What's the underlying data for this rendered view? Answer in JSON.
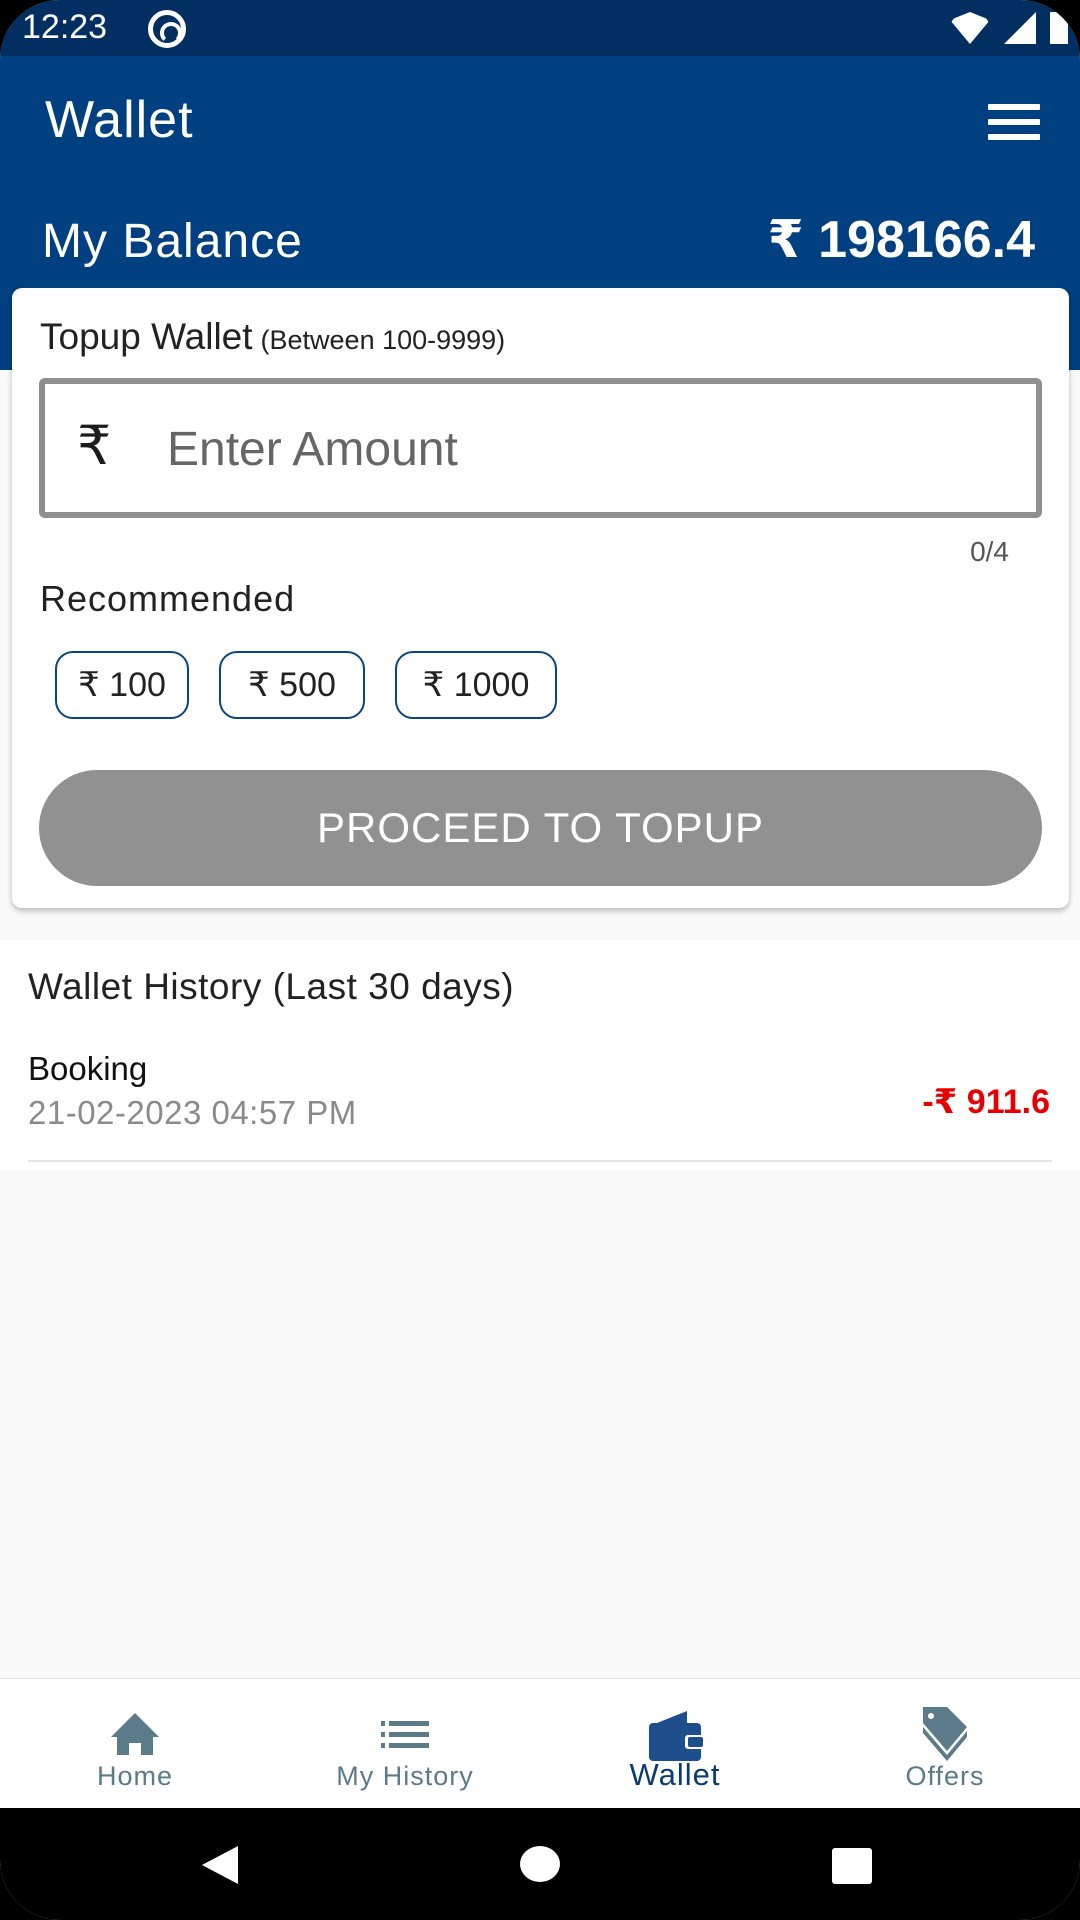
{
  "status_bar": {
    "time": "12:23"
  },
  "header": {
    "title": "Wallet",
    "menu_icon": "hamburger-menu-icon",
    "balance_label": "My Balance",
    "balance_value": "₹ 198166.4"
  },
  "topup": {
    "title": "Topup Wallet",
    "hint": "(Between 100-9999)",
    "currency_symbol": "₹",
    "amount_value": "",
    "amount_placeholder": "Enter Amount",
    "char_counter": "0/4",
    "recommended_label": "Recommended",
    "recommended_amounts": [
      "₹ 100",
      "₹ 500",
      "₹ 1000"
    ],
    "proceed_label": "PROCEED TO TOPUP",
    "proceed_enabled": false
  },
  "history": {
    "title": "Wallet History (Last 30 days)",
    "items": [
      {
        "type": "Booking",
        "date": "21-02-2023 04:57 PM",
        "amount": "-₹ 911.6"
      }
    ]
  },
  "bottom_nav": {
    "items": [
      {
        "label": "Home",
        "icon": "home-icon",
        "active": false
      },
      {
        "label": "My History",
        "icon": "list-icon",
        "active": false
      },
      {
        "label": "Wallet",
        "icon": "wallet-icon",
        "active": true
      },
      {
        "label": "Offers",
        "icon": "tag-icon",
        "active": false
      }
    ]
  },
  "colors": {
    "primary": "#003f80",
    "status_bar": "#022f61",
    "negative_amount": "#e80000",
    "disabled_button": "#919191",
    "nav_inactive": "#5b7a8a",
    "nav_active": "#0b3a74"
  }
}
